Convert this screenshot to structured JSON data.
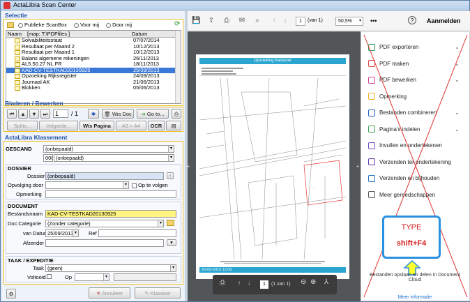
{
  "window": {
    "title": "ActaLibra Scan Center"
  },
  "selectie": {
    "header": "Selectie",
    "radios": [
      "Publieke ScanBox",
      "Voor mij",
      "Door mij"
    ],
    "columns": {
      "name": "Naam",
      "map": "[map: T:\\PDFfiles ]",
      "date": "Datum"
    },
    "files": [
      {
        "name": "Solvabiliteitsstaat",
        "date": "07/07/2014"
      },
      {
        "name": "Resultaat per Maand 2",
        "date": "10/12/2013"
      },
      {
        "name": "Resultaat per Maand 1",
        "date": "10/12/2013"
      },
      {
        "name": "Balans algemene rekeningen",
        "date": "26/11/2013"
      },
      {
        "name": "AL5.50.27 NL FR",
        "date": "18/11/2013"
      },
      {
        "name": "KAD-CV-TESTKAD20130925",
        "date": "25/09/2013"
      },
      {
        "name": "Opzoeking Rijksregister",
        "date": "24/09/2013"
      },
      {
        "name": "Journaal AK",
        "date": "21/06/2013"
      },
      {
        "name": "Blokken",
        "date": "05/06/2013"
      }
    ],
    "selected_index": 5
  },
  "bladeren": {
    "header": "Bladeren / Bewerken",
    "page": "1",
    "of": "/ 1",
    "wis_doc": "Wis Doc",
    "goto": "Go to...",
    "splits": "Splits...",
    "volgorde": "Volgorde...",
    "wis_pagina": "Wis Pagina",
    "a3a4": "A3 > A4",
    "ocr": "OCR"
  },
  "klassement": {
    "header": "ActaLibra Klassement",
    "gescand_label": "GESCAND",
    "gescand_1": "(onbepaald)",
    "gescand_2_code": "000",
    "gescand_2": "(onbepaald)",
    "dossier_title": "DOSSIER",
    "dossier_label": "Dossier",
    "dossier_value": "(onbepaald)",
    "opvolging_label": "Opvolging door",
    "op_te_volgen": "Op te volgen",
    "opmerking_label": "Opmerking",
    "document_title": "DOCUMENT",
    "bestandsnaam_label": "Bestandsnaam",
    "bestandsnaam_value": "KAD-CV-TESTKAD20130925",
    "doccat_label": "Doc.Categorie",
    "doccat_value": "(Zonder categorie)",
    "vandatum_label": "van Datum",
    "vandatum_value": "25/09/2013",
    "ref_label": "Ref",
    "afzender_label": "Afzender",
    "taak_title": "TAAK / EXPEDITIE",
    "taak_label": "Taak",
    "taak_value": "(geen)",
    "voltooid_label": "Voltooid",
    "op_label": "Op",
    "annuleer": "Annuleer",
    "klasseer": "Klasseer"
  },
  "viewer": {
    "page": "1",
    "of": "(van 1)",
    "zoom": "50,5%",
    "more": "•••",
    "help": "?",
    "signin": "Aanmelden",
    "doc_title": "Opzoeking Kadaster",
    "doc_footer": "20-09-2013 12:00",
    "float_page": "1",
    "float_of": "(1 van 1)"
  },
  "sidepanel": {
    "items": [
      {
        "label": "PDF exporteren",
        "color": "#2aa05a",
        "chev": true
      },
      {
        "label": "PDF maken",
        "color": "#e04848",
        "chev": true
      },
      {
        "label": "PDF bewerken",
        "color": "#d0409a",
        "chev": true
      },
      {
        "label": "Opmerking",
        "color": "#f0b020",
        "chev": false
      },
      {
        "label": "Bestanden combineren",
        "color": "#2060c0",
        "chev": true
      },
      {
        "label": "Pagina's indelen",
        "color": "#3aa050",
        "chev": true
      },
      {
        "label": "Invullen en ondertekenen",
        "color": "#6a4ac0",
        "chev": false
      },
      {
        "label": "Verzenden ter ondertekening",
        "color": "#5a3ab0",
        "chev": false
      },
      {
        "label": "Verzenden en bijhouden",
        "color": "#2070c0",
        "chev": false
      },
      {
        "label": "Meer gereedschappen",
        "color": "#555555",
        "chev": false
      }
    ],
    "annotation_type": "TYPE",
    "annotation_key": "shift+F4",
    "footer": "Bestanden opslaan en delen in Document Cloud",
    "link": "Meer informatie"
  },
  "colors": {
    "accent": "#1f4fa8",
    "highlight": "#fff580",
    "selection": "#3a78d8",
    "annotation": "#d42020"
  }
}
